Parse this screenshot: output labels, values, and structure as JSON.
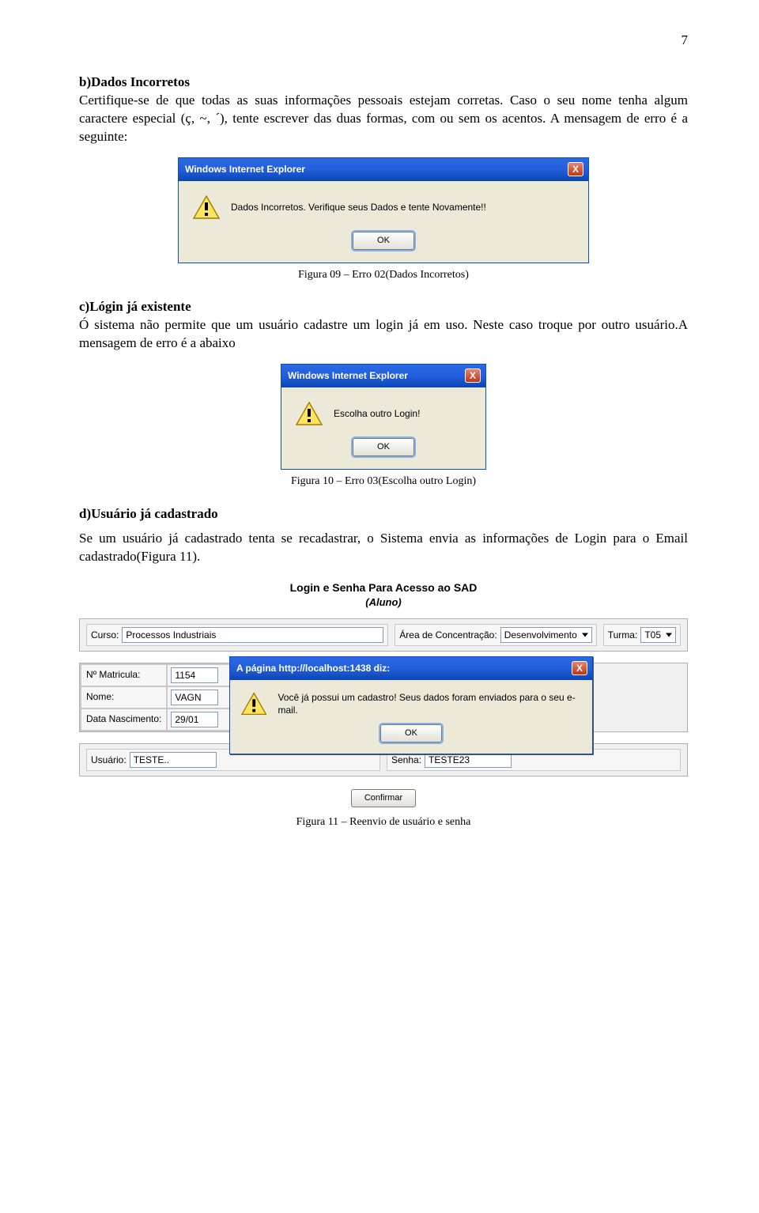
{
  "page_number": "7",
  "section_b": {
    "heading": "b)Dados Incorretos",
    "text": "Certifique-se de que todas as suas informações pessoais estejam corretas. Caso o seu nome tenha algum caractere especial (ç, ~, ´), tente escrever das duas formas, com ou sem os acentos. A mensagem de erro é a seguinte:"
  },
  "dialog1": {
    "title": "Windows Internet Explorer",
    "close": "X",
    "message": "Dados Incorretos. Verifique seus Dados e tente Novamente!!",
    "ok": "OK"
  },
  "caption1": "Figura 09 – Erro 02(Dados Incorretos)",
  "section_c": {
    "heading": "c)Lógin já existente",
    "text": "Ó sistema não permite que um usuário cadastre um login já em uso. Neste caso troque por outro usuário.A mensagem de erro é a abaixo"
  },
  "dialog2": {
    "title": "Windows Internet Explorer",
    "close": "X",
    "message": "Escolha outro Login!",
    "ok": "OK"
  },
  "caption2": "Figura 10 – Erro 03(Escolha outro Login)",
  "section_d": {
    "heading": "d)Usuário já cadastrado",
    "text": "Se um usuário já cadastrado tenta se recadastrar, o Sistema envia as informações de Login para o Email cadastrado(Figura 11)."
  },
  "form": {
    "title": "Login e Senha Para Acesso ao SAD",
    "subtitle": "(Aluno)",
    "curso_label": "Curso:",
    "curso_value": "Processos Industriais",
    "area_label": "Área de Concentração:",
    "area_value": "Desenvolvimento",
    "turma_label": "Turma:",
    "turma_value": "T05",
    "matricula_label": "Nº Matricula:",
    "matricula_value": "1154",
    "nome_label": "Nome:",
    "nome_value": "VAGN",
    "data_label": "Data Nascimento:",
    "data_value": "29/01",
    "usuario_label": "Usuário:",
    "usuario_value": "TESTE..",
    "senha_label": "Senha:",
    "senha_value": "TESTE23",
    "confirm": "Confirmar"
  },
  "prompt": {
    "title": "A página http://localhost:1438 diz:",
    "close": "X",
    "message": "Você já possui um cadastro! Seus dados foram enviados para o seu e-mail.",
    "ok": "OK"
  },
  "caption3": "Figura 11 – Reenvio de usuário e senha"
}
